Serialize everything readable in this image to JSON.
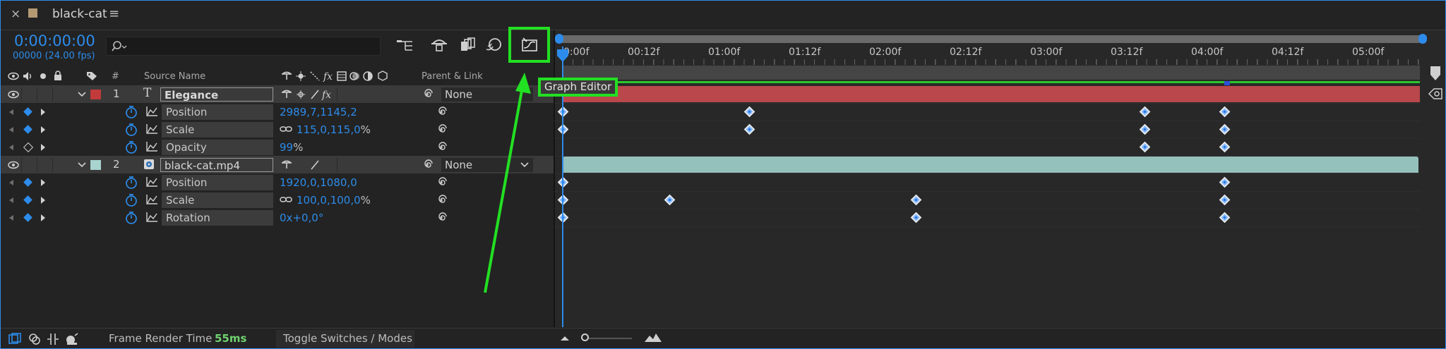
{
  "window": {
    "tab_title": "black-cat",
    "close_symbol": "×",
    "menu_symbol": "≡"
  },
  "header": {
    "timecode": "0:00:00:00",
    "frame_info": "00000 (24.00 fps)",
    "search_placeholder": ""
  },
  "columns": {
    "number": "#",
    "source_name": "Source Name",
    "parent_link": "Parent & Link"
  },
  "layers": [
    {
      "index": "1",
      "name": "Elegance",
      "type_glyph": "T",
      "label_color": "#c23a3a",
      "parent": "None",
      "bar_color": "#b9474b",
      "properties": [
        {
          "name": "Position",
          "value": "2989,7,1145,2",
          "unit": ""
        },
        {
          "name": "Scale",
          "value": "115,0,115,0",
          "unit": "%"
        },
        {
          "name": "Opacity",
          "value": "99",
          "unit": "%"
        }
      ]
    },
    {
      "index": "2",
      "name": "black-cat.mp4",
      "type_glyph": "",
      "label_color": "#a8d4d0",
      "parent": "None",
      "bar_color": "#94c1bc",
      "properties": [
        {
          "name": "Position",
          "value": "1920,0,1080,0",
          "unit": ""
        },
        {
          "name": "Scale",
          "value": "100,0,100,0",
          "unit": "%"
        },
        {
          "name": "Rotation",
          "value": "0x+0,0°",
          "unit": ""
        }
      ]
    }
  ],
  "timeline": {
    "ruler_labels": [
      "0:00f",
      "00:12f",
      "01:00f",
      "01:12f",
      "02:00f",
      "02:12f",
      "03:00f",
      "03:12f",
      "04:00f",
      "04:12f",
      "05:00f"
    ]
  },
  "tooltip": {
    "text": "Graph Editor"
  },
  "status": {
    "frame_render_label": "Frame Render Time",
    "frame_render_value": "55ms",
    "toggle_label": "Toggle Switches / Modes"
  },
  "colors": {
    "accent": "#2d8ceb",
    "highlight": "#22e022"
  }
}
